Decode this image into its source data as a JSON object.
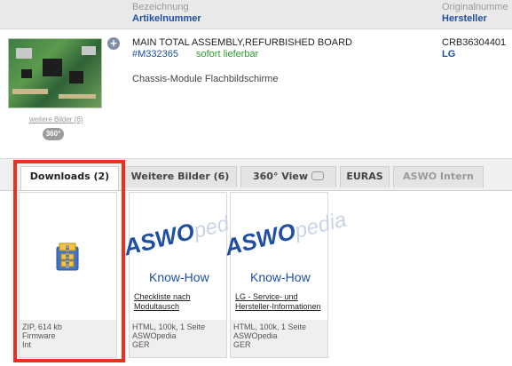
{
  "header": {
    "col1_line1": "Bezeichnung",
    "col1_line2": "Artikelnummer",
    "col2_line1": "Originalnumme",
    "col2_line2": "Hersteller"
  },
  "product": {
    "name": "MAIN TOTAL ASSEMBLY,REFURBISHED BOARD",
    "article_number": "#M332365",
    "availability": "sofort lieferbar",
    "category": "Chassis-Module Flachbildschirme",
    "original_number": "CRB36304401",
    "manufacturer": "LG",
    "more_images_link": "weitere Bilder (6)",
    "badge_360": "360°",
    "zoom_symbol": "+"
  },
  "tabs": [
    {
      "label": "Downloads (2)",
      "active": true
    },
    {
      "label": "Weitere Bilder (6)",
      "active": false
    },
    {
      "label": "360° View",
      "active": false
    },
    {
      "label": "EURAS",
      "active": false
    },
    {
      "label": "ASWO Intern",
      "active": false
    }
  ],
  "downloads": [
    {
      "icon": "zip-archive-icon",
      "footer": [
        "ZIP, 614 kb",
        "Firmware",
        "Int"
      ]
    },
    {
      "logo_text": "ASWO",
      "logo_suffix": "pedia",
      "heading": "Know-How",
      "title": "Checkliste nach Modultausch",
      "footer": [
        "HTML, 100k, 1 Seite",
        "ASWOpedia",
        "GER"
      ]
    },
    {
      "logo_text": "ASWO",
      "logo_suffix": "pedia",
      "heading": "Know-How",
      "title": "LG - Service- und Hersteller-Informationen",
      "footer": [
        "HTML, 100k, 1 Seite",
        "ASWOpedia",
        "GER"
      ]
    }
  ],
  "colors": {
    "link": "#1f4fa3",
    "available": "#2e9a2e",
    "highlight": "#e8321f"
  }
}
